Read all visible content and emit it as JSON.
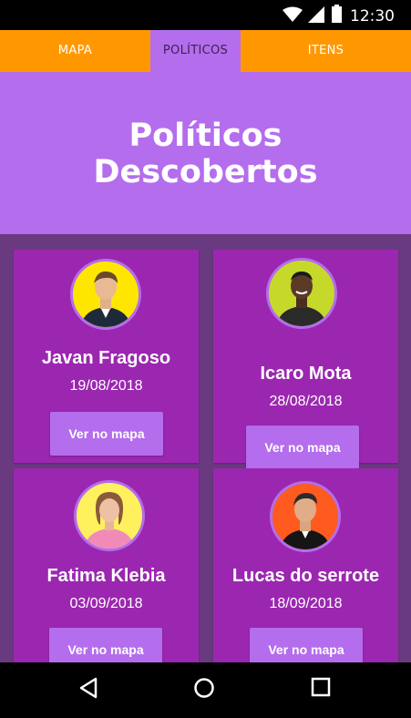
{
  "status": {
    "time": "12:30"
  },
  "tabs": [
    {
      "label": "MAPA",
      "active": false
    },
    {
      "label": "POLÍTICOS",
      "active": true
    },
    {
      "label": "ITENS",
      "active": false
    }
  ],
  "hero": {
    "title_line1": "Políticos",
    "title_line2": "Descobertos"
  },
  "politicians": [
    {
      "name": "Javan Fragoso",
      "date": "19/08/2018",
      "button": "Ver no mapa",
      "avatar_bg": "#ffe600"
    },
    {
      "name": "Icaro Mota",
      "date": "28/08/2018",
      "button": "Ver no mapa",
      "avatar_bg": "#c6d92b"
    },
    {
      "name": "Fatima Klebia",
      "date": "03/09/2018",
      "button": "Ver no mapa",
      "avatar_bg": "#fff15e"
    },
    {
      "name": "Lucas do serrote",
      "date": "18/09/2018",
      "button": "Ver no mapa",
      "avatar_bg": "#ff5a1f"
    }
  ],
  "colors": {
    "accent_orange": "#ff9800",
    "purple_light": "#b46ded",
    "purple_card": "#9b27b0",
    "purple_bg": "#6a3a80"
  },
  "navbar": {
    "icons": [
      "back-triangle-icon",
      "home-circle-icon",
      "recents-square-icon"
    ]
  }
}
